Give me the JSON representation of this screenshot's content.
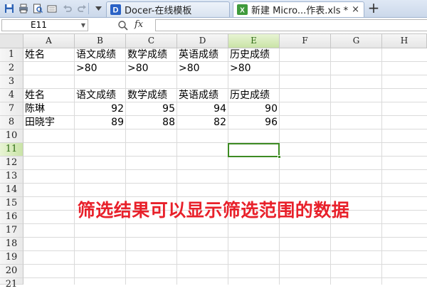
{
  "colors": {
    "accent": "#3d8b23",
    "caption": "#e8202a"
  },
  "toolbar": {
    "icons": [
      "save-icon",
      "print-icon",
      "print-preview-icon",
      "undo-icon",
      "redo-icon",
      "dropdown-icon"
    ]
  },
  "tabs": [
    {
      "label": "Docer-在线模板",
      "icon": "docer-icon",
      "active": false
    },
    {
      "label": "新建 Micro...作表.xls *",
      "icon": "excel-icon",
      "active": true,
      "close": "×"
    }
  ],
  "new_tab_label": "+",
  "formula_bar": {
    "name_box": "E11",
    "fx": "fx",
    "formula": ""
  },
  "columns": [
    "A",
    "B",
    "C",
    "D",
    "E",
    "F",
    "G",
    "H"
  ],
  "selected_column": "E",
  "rows": [
    "1",
    "2",
    "3",
    "4",
    "7",
    "8",
    "10",
    "11",
    "12",
    "13",
    "14",
    "15",
    "16",
    "17",
    "18",
    "19",
    "20",
    "21"
  ],
  "selected_row": "11",
  "active_cell": "E11",
  "sheet": {
    "criteria_header": [
      "姓名",
      "语文成绩",
      "数学成绩",
      "英语成绩",
      "历史成绩"
    ],
    "criteria_values": [
      "",
      ">80",
      ">80",
      ">80",
      ">80"
    ],
    "result_header": [
      "姓名",
      "语文成绩",
      "数学成绩",
      "英语成绩",
      "历史成绩"
    ],
    "results": [
      {
        "name": "陈琳",
        "chinese": "92",
        "math": "95",
        "english": "94",
        "history": "90"
      },
      {
        "name": "田晓宇",
        "chinese": "89",
        "math": "88",
        "english": "82",
        "history": "96"
      }
    ]
  },
  "caption": "筛选结果可以显示筛选范围的数据"
}
